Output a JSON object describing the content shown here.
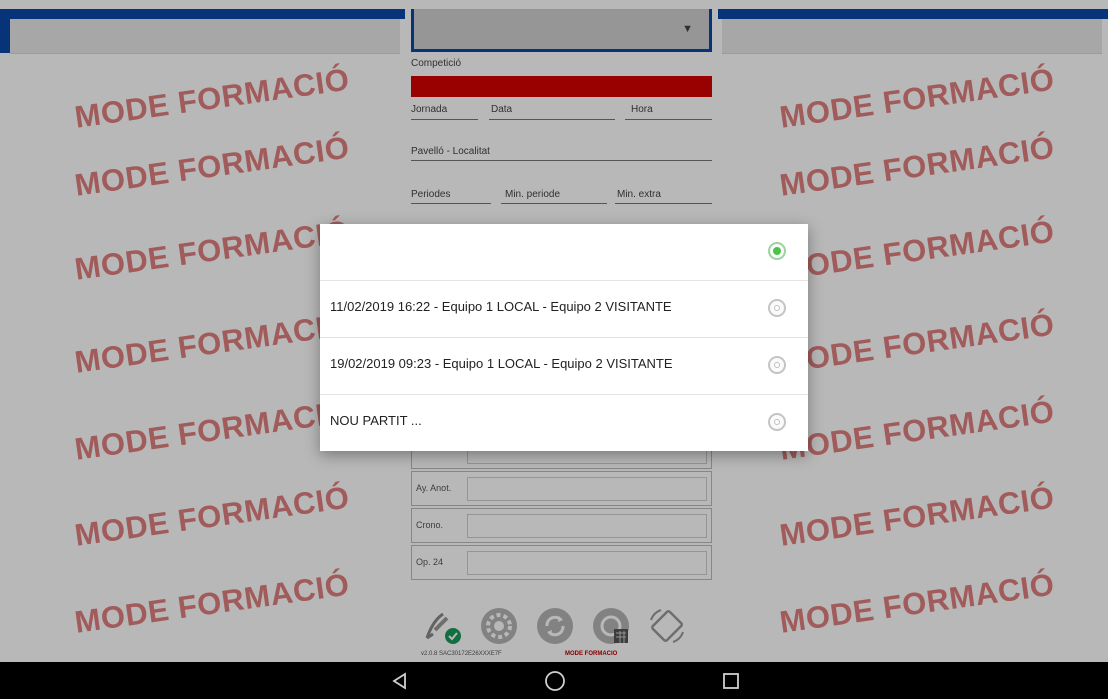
{
  "form": {
    "dropdown_arrow": "▼",
    "competicio_label": "Competició",
    "jornada_label": "Jornada",
    "data_label": "Data",
    "hora_label": "Hora",
    "pavello_label": "Pavelló - Localitat",
    "periodes_label": "Periodes",
    "min_periode_label": "Min. periode",
    "min_extra_label": "Min. extra",
    "rows": [
      {
        "label": ""
      },
      {
        "label": "Ay. Anot."
      },
      {
        "label": "Crono."
      },
      {
        "label": "Op. 24"
      }
    ],
    "footer_version": "v2.0.8 SAC30172E26XXXE7F",
    "footer_mode": "MODE FORMACIO"
  },
  "watermark": "MODE FORMACIÓ",
  "dialog": {
    "options": [
      {
        "label": "",
        "selected": true
      },
      {
        "label": "11/02/2019 16:22 - Equipo 1 LOCAL - Equipo 2 VISITANTE",
        "selected": false
      },
      {
        "label": "19/02/2019 09:23 - Equipo 1 LOCAL - Equipo 2 VISITANTE",
        "selected": false
      },
      {
        "label": "NOU PARTIT ...",
        "selected": false
      }
    ]
  },
  "colors": {
    "accent_blue": "#0a47a8",
    "competicio_red": "#d40000",
    "radio_selected": "#4cc24c",
    "watermark": "#e07f7f"
  },
  "icons": {
    "toolbar": [
      "signature-check-icon",
      "settings-gear-icon",
      "sync-icon",
      "calendar-settings-icon",
      "rotate-screen-icon"
    ],
    "navbar": [
      "back-triangle-icon",
      "home-circle-icon",
      "recents-square-icon"
    ]
  }
}
